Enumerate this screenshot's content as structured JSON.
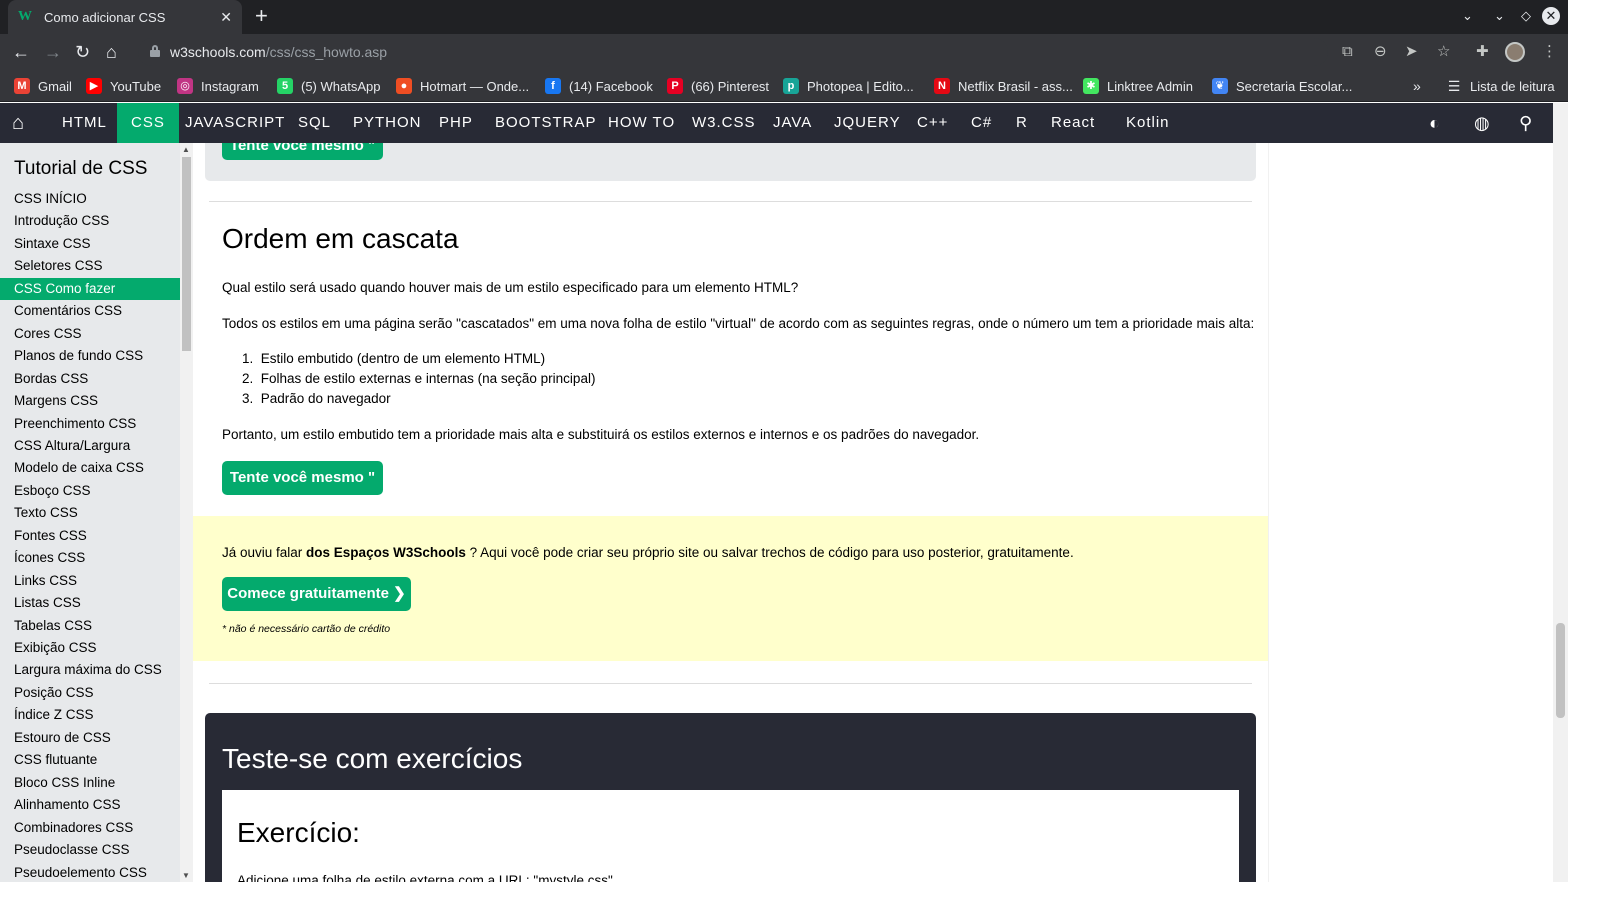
{
  "browser": {
    "tab_title": "Como adicionar CSS",
    "favicon_text": "W",
    "url_host": "w3schools.com",
    "url_path": "/css/css_howto.asp",
    "bookmarks": [
      {
        "label": "Gmail",
        "icon": "gmail-icon",
        "icon_text": "M",
        "color": "#ea4335"
      },
      {
        "label": "YouTube",
        "icon": "youtube-icon",
        "icon_text": "▶",
        "color": "#ff0000"
      },
      {
        "label": "Instagram",
        "icon": "instagram-icon",
        "icon_text": "◎",
        "color": "#c13584"
      },
      {
        "label": "(5) WhatsApp",
        "icon": "whatsapp-icon",
        "icon_text": "5",
        "color": "#25d366"
      },
      {
        "label": "Hotmart — Onde...",
        "icon": "hotmart-icon",
        "icon_text": "●",
        "color": "#ef4e23"
      },
      {
        "label": "(14) Facebook",
        "icon": "facebook-icon",
        "icon_text": "f",
        "color": "#1877f2"
      },
      {
        "label": "(66) Pinterest",
        "icon": "pinterest-icon",
        "icon_text": "P",
        "color": "#e60023"
      },
      {
        "label": "Photopea | Edito...",
        "icon": "photopea-icon",
        "icon_text": "p",
        "color": "#18a497"
      },
      {
        "label": "Netflix Brasil - ass...",
        "icon": "netflix-icon",
        "icon_text": "N",
        "color": "#e50914"
      },
      {
        "label": "Linktree Admin",
        "icon": "linktree-icon",
        "icon_text": "✱",
        "color": "#43e660"
      },
      {
        "label": "Secretaria Escolar...",
        "icon": "secretaria-icon",
        "icon_text": "❦",
        "color": "#4285f4"
      }
    ],
    "reading_list": "Lista de leitura"
  },
  "nav": {
    "items": [
      "HTML",
      "CSS",
      "JAVASCRIPT",
      "SQL",
      "PYTHON",
      "PHP",
      "BOOTSTRAP",
      "HOW TO",
      "W3.CSS",
      "JAVA",
      "JQUERY",
      "C++",
      "C#",
      "R",
      "React",
      "Kotlin"
    ],
    "active": "CSS",
    "accent": "#04aa6d"
  },
  "sidebar": {
    "title": "Tutorial de CSS",
    "items": [
      "CSS INÍCIO",
      "Introdução CSS",
      "Sintaxe CSS",
      "Seletores CSS",
      "CSS Como fazer",
      "Comentários CSS",
      "Cores CSS",
      "Planos de fundo CSS",
      "Bordas CSS",
      "Margens CSS",
      "Preenchimento CSS",
      "CSS Altura/Largura",
      "Modelo de caixa CSS",
      "Esboço CSS",
      "Texto CSS",
      "Fontes CSS",
      "Ícones CSS",
      "Links CSS",
      "Listas CSS",
      "Tabelas CSS",
      "Exibição CSS",
      "Largura máxima do CSS",
      "Posição CSS",
      "Índice Z CSS",
      "Estouro de CSS",
      "CSS flutuante",
      "Bloco CSS Inline",
      "Alinhamento CSS",
      "Combinadores CSS",
      "Pseudoclasse CSS",
      "Pseudoelemento CSS"
    ],
    "active": "CSS Como fazer"
  },
  "main": {
    "top_button": "Tente você mesmo \"",
    "heading": "Ordem em cascata",
    "p1": "Qual estilo será usado quando houver mais de um estilo especificado para um elemento HTML?",
    "p2": "Todos os estilos em uma página serão \"cascatados\" em uma nova folha de estilo \"virtual\" de acordo com as seguintes regras, onde o número um tem a prioridade mais alta:",
    "list": [
      "Estilo embutido (dentro de um elemento HTML)",
      "Folhas de estilo externas e internas (na seção principal)",
      "Padrão do navegador"
    ],
    "p3": "Portanto, um estilo embutido tem a prioridade mais alta e substituirá os estilos externos e internos e os padrões do navegador.",
    "try_button": "Tente você mesmo \"",
    "spaces_pre": "Já ouviu falar ",
    "spaces_bold": "dos Espaços W3Schools",
    "spaces_post": " ? Aqui você pode criar seu próprio site ou salvar trechos de código para uso posterior, gratuitamente.",
    "spaces_button": "Comece gratuitamente ❯",
    "spaces_note": "* não é necessário cartão de crédito",
    "exercises_title": "Teste-se com exercícios",
    "exercise_heading": "Exercício:",
    "exercise_question": "Adicione uma folha de estilo externa com a URL: \"mystyle.css\"."
  }
}
